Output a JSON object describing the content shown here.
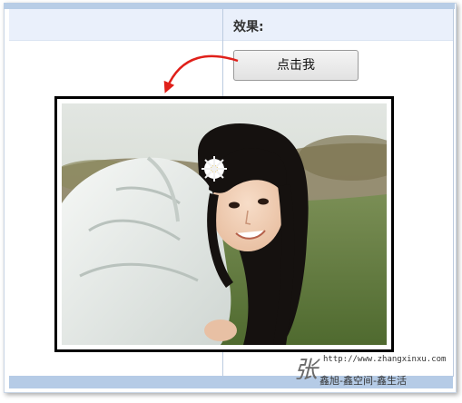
{
  "header": {
    "effect_label": "效果:"
  },
  "demo": {
    "button_label": "点击我"
  },
  "watermark": {
    "char": "张",
    "url": "http://www.zhangxinxu.com",
    "subtitle": "鑫旭-鑫空间-鑫生活"
  },
  "colors": {
    "header_bg": "#eaf0fb",
    "band": "#b5cbe6",
    "arrow": "#e0201a",
    "photo_border": "#000000"
  }
}
